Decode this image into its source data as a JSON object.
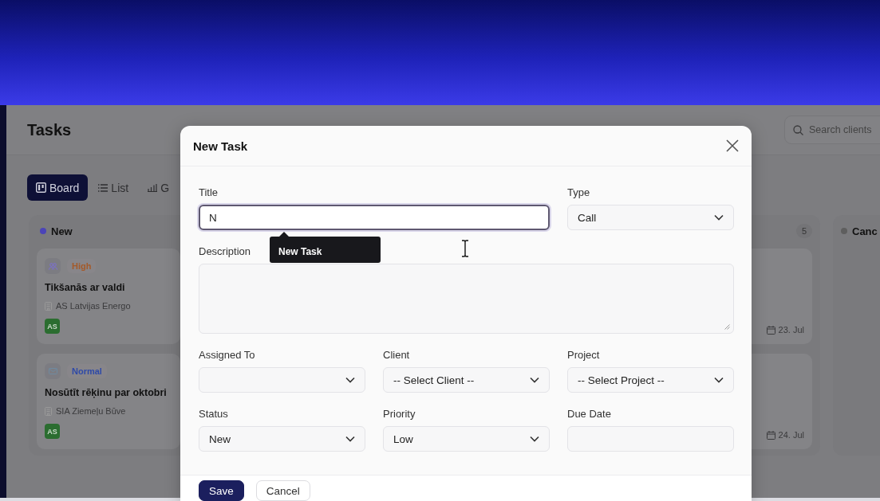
{
  "page": {
    "title": "Tasks",
    "search": {
      "placeholder": "Search clients"
    }
  },
  "view_tabs": [
    {
      "label": "Board",
      "selected": true
    },
    {
      "label": "List",
      "selected": false
    },
    {
      "label": "G",
      "selected": false
    }
  ],
  "board": {
    "columns": [
      {
        "title": "New",
        "color": "#4b44b8",
        "cards": [
          {
            "kind": "meeting",
            "priority": {
              "label": "High",
              "color": "#a45a2a"
            },
            "title": "Tikšanās ar valdi",
            "client": "AS Latvijas Energo",
            "assignee": "AS"
          },
          {
            "kind": "email",
            "priority": {
              "label": "Normal",
              "color": "#2e4aa8"
            },
            "title": "Nosūtīt rēķinu par oktobri",
            "client": "SIA Ziemeļu Būve",
            "assignee": "AS"
          }
        ]
      },
      {
        "count": "5",
        "cards": [
          {
            "due": "23. Jul"
          },
          {
            "due": "24. Jul"
          }
        ]
      },
      {
        "title": "Canc",
        "color": "#5e5e5e"
      }
    ]
  },
  "modal": {
    "title": "New Task",
    "rows": [
      [
        {
          "kind": "text",
          "label": "Title",
          "value": "N",
          "focused": true,
          "suggestion": "New Task"
        },
        "",
        {
          "kind": "select",
          "label": "Type",
          "value": "Call",
          "focused": false
        }
      ],
      [
        {
          "kind": "textarea",
          "label": "Description",
          "focused": false
        }
      ],
      [
        {
          "kind": "select",
          "label": "Assigned To",
          "focused": false
        },
        {
          "kind": "select",
          "label": "Client",
          "value": "-- Select Client --",
          "focused": false
        },
        {
          "kind": "select",
          "label": "Project",
          "value": "-- Select Project --",
          "focused": false
        }
      ],
      [
        {
          "kind": "select",
          "label": "Status",
          "value": "New",
          "focused": false
        },
        {
          "kind": "select",
          "label": "Priority",
          "value": "Low",
          "focused": false
        },
        {
          "kind": "date",
          "label": "Due Date",
          "focused": false
        }
      ]
    ],
    "buttons": [
      {
        "label": "Save",
        "kind": "primary"
      },
      {
        "label": "Cancel",
        "kind": "secondary"
      }
    ]
  }
}
